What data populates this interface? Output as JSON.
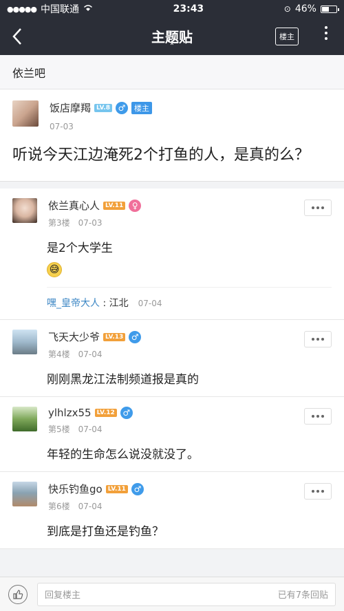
{
  "status": {
    "carrier": "中国联通",
    "time": "23:43",
    "battery": "46%",
    "battery_level": 0.46
  },
  "nav": {
    "title": "主题贴",
    "owner_button": "楼主"
  },
  "forum": {
    "name": "依兰吧"
  },
  "op": {
    "username": "饭店摩羯",
    "level": "LV.8",
    "owner_tag": "楼主",
    "date": "07-03",
    "content": "听说今天江边淹死2个打鱼的人，是真的么？"
  },
  "replies": [
    {
      "username": "依兰真心人",
      "level": "LV.11",
      "floor": "第3楼",
      "date": "07-03",
      "content": "是2个大学生",
      "subreply": {
        "name": "嘿_皇帝大人",
        "text": " : 江北",
        "date": "07-04"
      }
    },
    {
      "username": "飞天大少爷",
      "level": "LV.13",
      "floor": "第4楼",
      "date": "07-04",
      "content": "刚刚黑龙江法制频道报是真的"
    },
    {
      "username": "ylhlzx55",
      "level": "LV.12",
      "floor": "第5楼",
      "date": "07-04",
      "content": "年轻的生命怎么说没就没了。"
    },
    {
      "username": "快乐钓鱼go",
      "level": "LV.11",
      "floor": "第6楼",
      "date": "07-04",
      "content": "到底是打鱼还是钓鱼？"
    }
  ],
  "bottom": {
    "placeholder": "回复楼主",
    "count_text": "已有7条回贴"
  }
}
